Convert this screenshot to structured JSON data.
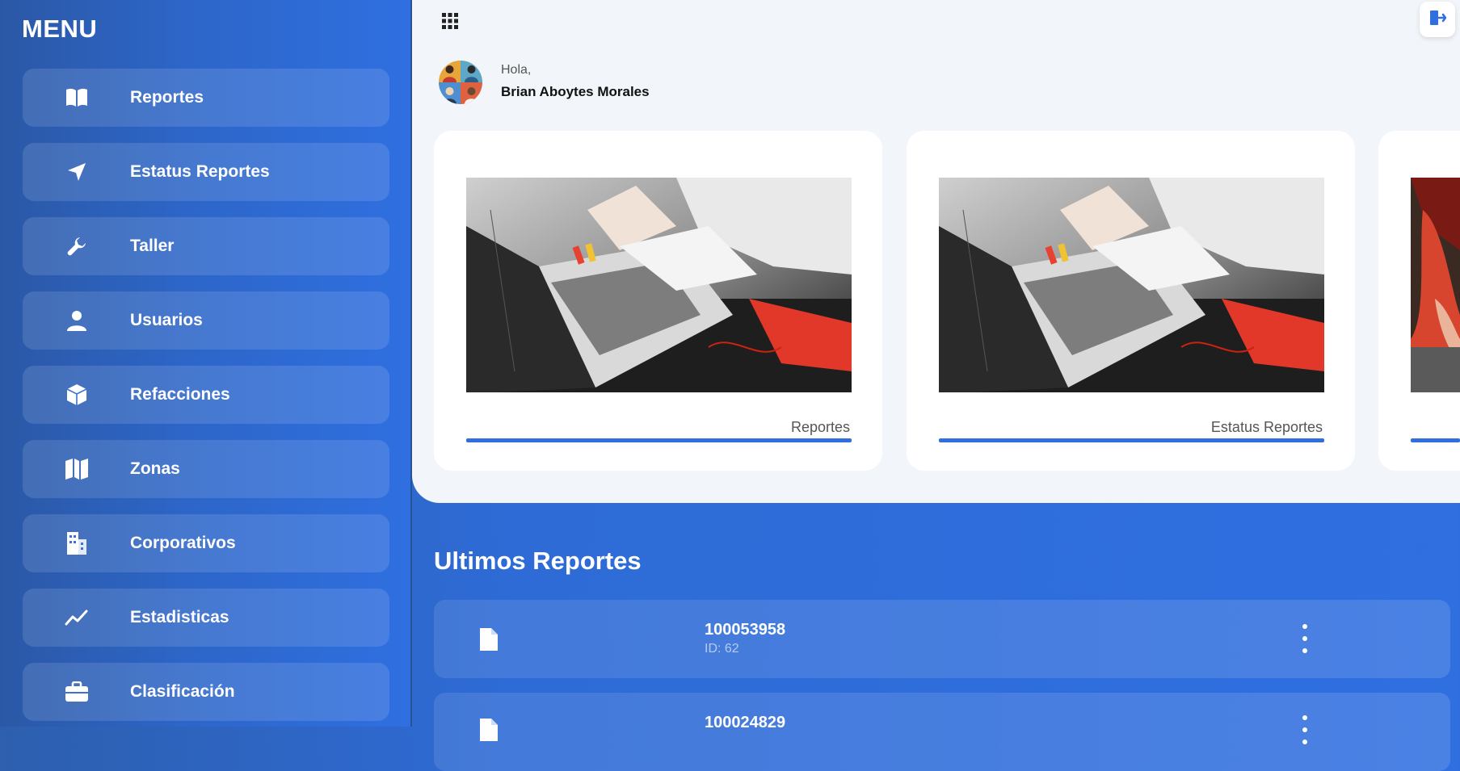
{
  "sidebar": {
    "title": "MENU",
    "items": [
      {
        "label": "Reportes",
        "icon": "book-icon"
      },
      {
        "label": "Estatus Reportes",
        "icon": "navigation-arrow-icon"
      },
      {
        "label": "Taller",
        "icon": "wrench-icon"
      },
      {
        "label": "Usuarios",
        "icon": "user-icon"
      },
      {
        "label": "Refacciones",
        "icon": "cube-icon"
      },
      {
        "label": "Zonas",
        "icon": "map-icon"
      },
      {
        "label": "Corporativos",
        "icon": "building-icon"
      },
      {
        "label": "Estadisticas",
        "icon": "trend-chart-icon"
      },
      {
        "label": "Clasificación",
        "icon": "briefcase-icon"
      }
    ]
  },
  "header": {
    "greeting": "Hola,",
    "user_name": "Brian Aboytes Morales"
  },
  "cards": [
    {
      "caption": "Reportes"
    },
    {
      "caption": "Estatus Reportes"
    },
    {
      "caption": ""
    }
  ],
  "latest": {
    "title": "Ultimos Reportes",
    "reports": [
      {
        "number": "100053958",
        "id": "ID: 62"
      },
      {
        "number": "100024829",
        "id": ""
      }
    ]
  },
  "colors": {
    "accent": "#2f6fe0",
    "panel_bg": "#f2f5f9"
  }
}
